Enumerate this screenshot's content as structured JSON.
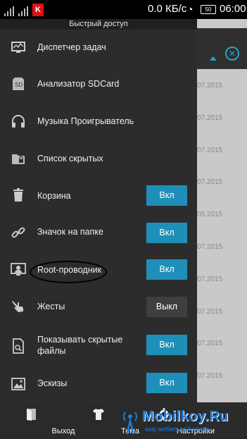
{
  "status_bar": {
    "speed": "0.0 КБ/с",
    "battery": "50",
    "time": "06:00"
  },
  "drawer": {
    "title": "Быстрый доступ",
    "items": [
      {
        "label": "Диспетчер задач",
        "icon": "task-manager-icon"
      },
      {
        "label": "Анализатор SDCard",
        "icon": "sdcard-icon"
      },
      {
        "label": "Музыка Проигрыватель",
        "icon": "headphones-icon"
      },
      {
        "label": "Список скрытых",
        "icon": "locked-folder-icon"
      },
      {
        "label": "Корзина",
        "icon": "trash-icon",
        "toggle": "Вкл",
        "state": "on"
      },
      {
        "label": "Значок на папке",
        "icon": "link-icon",
        "toggle": "Вкл",
        "state": "on"
      },
      {
        "label": "Root-проводник",
        "icon": "root-explorer-icon",
        "toggle": "Вкл",
        "state": "on"
      },
      {
        "label": "Жесты",
        "icon": "gesture-hand-icon",
        "toggle": "Выкл",
        "state": "off"
      },
      {
        "label": "Показывать скрытые файлы",
        "label_line1": "Показывать скрытые",
        "label_line2": "файлы",
        "icon": "hidden-file-icon",
        "toggle": "Вкл",
        "state": "on"
      },
      {
        "label": "Эскизы",
        "icon": "thumbnail-icon",
        "toggle": "Вкл",
        "state": "on"
      }
    ]
  },
  "bottom_bar": {
    "exit": "Выход",
    "theme": "Тема",
    "settings": "Настройки"
  },
  "background_dates": [
    "07.2015",
    "07.2015",
    "07.2015",
    "07.2015",
    "05.2015",
    "07.2015",
    "07.2015",
    "07.2015",
    "07.2015",
    "07.2015",
    "07.2015"
  ],
  "watermark": {
    "name": "Mobilkoy.Ru",
    "tagline": "мир мобильной связи"
  },
  "colors": {
    "accent": "#1f8fb9",
    "drawer_bg": "#2c2c2c",
    "status_bg": "#000000"
  }
}
